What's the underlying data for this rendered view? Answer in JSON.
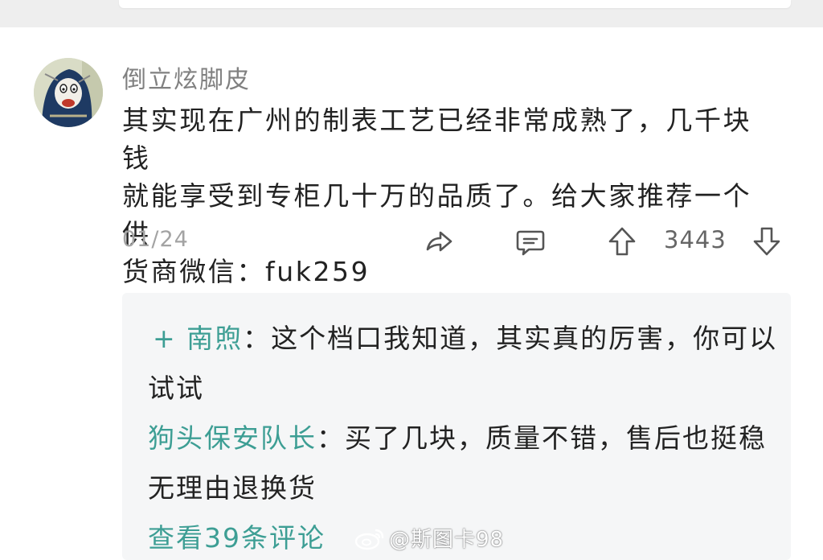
{
  "comment": {
    "username": "倒立炫脚皮",
    "body": "其实现在广州的制表工艺已经非常成熟了，几千块钱\n就能享受到专柜几十万的品质了。给大家推荐一个供\n货商微信：fuk259",
    "date": "01/24",
    "vote_count": "3443",
    "icons": [
      "share-icon",
      "comment-icon",
      "upvote-icon",
      "downvote-icon"
    ]
  },
  "replies": {
    "items": [
      {
        "prefix": "+ ",
        "author": "南煦",
        "separator": "：",
        "text": "这个档口我知道，其实真的厉害，你可以试试"
      },
      {
        "prefix": "",
        "author": "狗头保安队长",
        "separator": "：",
        "text": "买了几块，质量不错，售后也挺稳无理由退换货"
      }
    ],
    "view_more": "查看39条评论"
  },
  "watermark": {
    "text": "@斯图卡98"
  },
  "colors": {
    "accent": "#3d9e94",
    "text": "#222222",
    "muted": "#808080",
    "reply_bg": "#f5f6f7"
  }
}
